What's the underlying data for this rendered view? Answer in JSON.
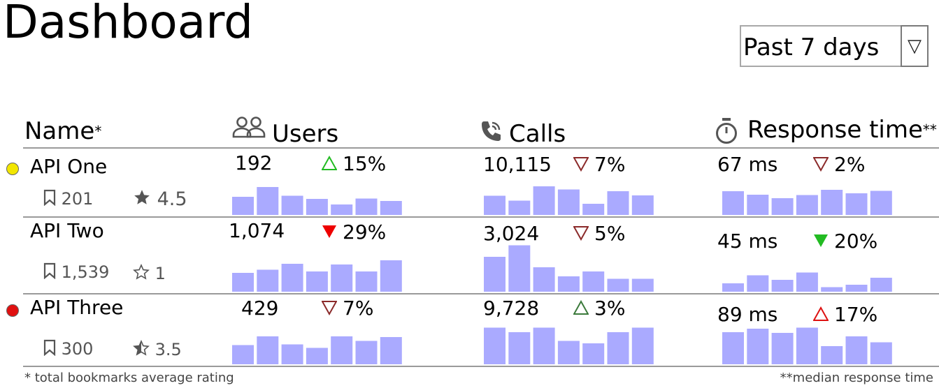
{
  "header": {
    "title": "Dashboard"
  },
  "range": {
    "selected": "Past 7 days"
  },
  "columns": {
    "name": {
      "label": "Name",
      "marker": "*"
    },
    "users": {
      "label": "Users",
      "icon": "users-icon"
    },
    "calls": {
      "label": "Calls",
      "icon": "phone-icon"
    },
    "response": {
      "label": "Response time",
      "marker": "**",
      "icon": "stopwatch-icon"
    }
  },
  "colors": {
    "bar": "#aaaaff",
    "status_yellow": "#f2e600",
    "status_red": "#e01010",
    "up_green": "#22bb22",
    "down_red": "#ee0000",
    "outline_dark_red": "#8b2a2a",
    "outline_dark_green": "#3b7a3b"
  },
  "rows": [
    {
      "name": "API One",
      "status": "yellow",
      "bookmarks": "201",
      "rating": "4.5",
      "rating_icon": "star-filled-icon",
      "users": {
        "value": "192",
        "delta": "15%",
        "trend": "up-outline",
        "spark": [
          0.52,
          0.8,
          0.55,
          0.46,
          0.3,
          0.47,
          0.4
        ]
      },
      "calls": {
        "value": "10,115",
        "delta": "7%",
        "trend": "down-outline",
        "spark": [
          0.55,
          0.41,
          0.82,
          0.73,
          0.32,
          0.68,
          0.56
        ]
      },
      "response": {
        "value": "67 ms",
        "delta": "2%",
        "trend": "down-outline",
        "spark": [
          0.68,
          0.58,
          0.48,
          0.57,
          0.72,
          0.62,
          0.69
        ]
      }
    },
    {
      "name": "API Two",
      "status": "none",
      "bookmarks": "1,539",
      "rating": "1",
      "rating_icon": "star-outline-icon",
      "users": {
        "value": "1,074",
        "delta": "29%",
        "trend": "down-solid",
        "spark": [
          0.54,
          0.63,
          0.8,
          0.58,
          0.78,
          0.58,
          0.9
        ]
      },
      "calls": {
        "value": "3,024",
        "delta": "5%",
        "trend": "down-outline",
        "spark": [
          1.0,
          1.33,
          0.7,
          0.44,
          0.58,
          0.37,
          0.37
        ]
      },
      "response": {
        "value": "45 ms",
        "delta": "20%",
        "trend": "down-solid-green",
        "spark": [
          0.24,
          0.47,
          0.34,
          0.55,
          0.13,
          0.2,
          0.4
        ]
      }
    },
    {
      "name": "API Three",
      "status": "red",
      "bookmarks": "300",
      "rating": "3.5",
      "rating_icon": "star-half-icon",
      "users": {
        "value": "429",
        "delta": "7%",
        "trend": "down-outline",
        "spark": [
          0.55,
          0.8,
          0.57,
          0.47,
          0.8,
          0.67,
          0.78
        ]
      },
      "calls": {
        "value": "9,728",
        "delta": "3%",
        "trend": "up-outline-green",
        "spark": [
          1.05,
          0.92,
          1.05,
          0.67,
          0.6,
          0.92,
          1.05
        ]
      },
      "response": {
        "value": "89 ms",
        "delta": "17%",
        "trend": "up-outline-red",
        "spark": [
          0.92,
          1.02,
          0.9,
          1.05,
          0.52,
          0.8,
          0.63
        ]
      }
    }
  ],
  "footer": {
    "left": "* total bookmarks average rating",
    "right": "**median response time"
  }
}
